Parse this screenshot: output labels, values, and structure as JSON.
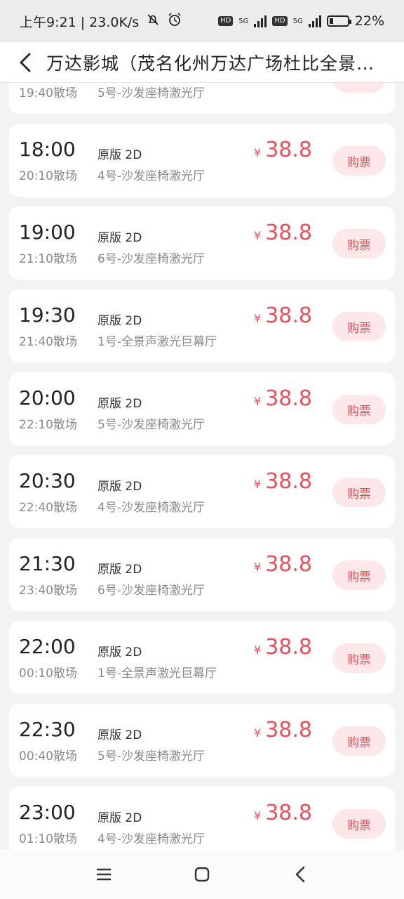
{
  "status_bar": {
    "time_speed": "上午9:21 | 23.0K/s",
    "net_badge_1": "HD",
    "net_badge_2": "HD",
    "network_type": "5G",
    "battery": "22%",
    "battery_level": 0.22
  },
  "header": {
    "title": "万达影城（茂名化州万达广场杜比全景…"
  },
  "showtimes": [
    {
      "start": "",
      "end": "19:40散场",
      "version": "",
      "hall": "5号-沙发座椅激光厅",
      "currency": "",
      "price": "",
      "buy_label": ""
    },
    {
      "start": "18:00",
      "end": "20:10散场",
      "version": "原版 2D",
      "hall": "4号-沙发座椅激光厅",
      "currency": "¥",
      "price": "38.8",
      "buy_label": "购票"
    },
    {
      "start": "19:00",
      "end": "21:10散场",
      "version": "原版 2D",
      "hall": "6号-沙发座椅激光厅",
      "currency": "¥",
      "price": "38.8",
      "buy_label": "购票"
    },
    {
      "start": "19:30",
      "end": "21:40散场",
      "version": "原版 2D",
      "hall": "1号-全景声激光巨幕厅",
      "currency": "¥",
      "price": "38.8",
      "buy_label": "购票"
    },
    {
      "start": "20:00",
      "end": "22:10散场",
      "version": "原版 2D",
      "hall": "5号-沙发座椅激光厅",
      "currency": "¥",
      "price": "38.8",
      "buy_label": "购票"
    },
    {
      "start": "20:30",
      "end": "22:40散场",
      "version": "原版 2D",
      "hall": "4号-沙发座椅激光厅",
      "currency": "¥",
      "price": "38.8",
      "buy_label": "购票"
    },
    {
      "start": "21:30",
      "end": "23:40散场",
      "version": "原版 2D",
      "hall": "6号-沙发座椅激光厅",
      "currency": "¥",
      "price": "38.8",
      "buy_label": "购票"
    },
    {
      "start": "22:00",
      "end": "00:10散场",
      "version": "原版 2D",
      "hall": "1号-全景声激光巨幕厅",
      "currency": "¥",
      "price": "38.8",
      "buy_label": "购票"
    },
    {
      "start": "22:30",
      "end": "00:40散场",
      "version": "原版 2D",
      "hall": "5号-沙发座椅激光厅",
      "currency": "¥",
      "price": "38.8",
      "buy_label": "购票"
    },
    {
      "start": "23:00",
      "end": "01:10散场",
      "version": "原版 2D",
      "hall": "4号-沙发座椅激光厅",
      "currency": "¥",
      "price": "38.8",
      "buy_label": "购票"
    }
  ],
  "watermark": "",
  "colors": {
    "accent": "#e8505b",
    "button_bg": "#fde7e8",
    "page_bg": "#f3f3f3"
  },
  "icons": {
    "back": "chevron-left-icon",
    "nav_menu": "menu-icon",
    "nav_home": "home-icon",
    "nav_back": "back-icon"
  }
}
